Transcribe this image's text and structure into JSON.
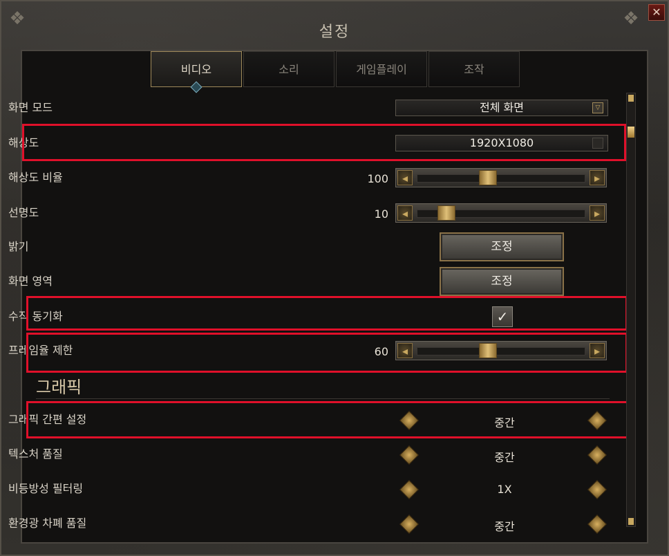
{
  "window": {
    "title": "설정",
    "close_label": "✕"
  },
  "tabs": [
    {
      "label": "비디오",
      "active": true
    },
    {
      "label": "소리",
      "active": false
    },
    {
      "label": "게임플레이",
      "active": false
    },
    {
      "label": "조작",
      "active": false
    }
  ],
  "settings": {
    "screen_mode": {
      "label": "화면 모드",
      "value": "전체 화면",
      "control": "dropdown"
    },
    "resolution": {
      "label": "해상도",
      "value": "1920X1080",
      "control": "dropdown"
    },
    "resolution_scale": {
      "label": "해상도 비율",
      "value": "100",
      "control": "slider",
      "level": 0.4
    },
    "sharpness": {
      "label": "선명도",
      "value": "10",
      "control": "slider",
      "level": 0.1
    },
    "brightness": {
      "label": "밝기",
      "button": "조정"
    },
    "screen_area": {
      "label": "화면 영역",
      "button": "조정"
    },
    "vsync": {
      "label": "수직 동기화",
      "checked": true,
      "check_glyph": "✓"
    },
    "frame_limit": {
      "label": "프레임율 제한",
      "value": "60",
      "control": "slider",
      "level": 0.4
    }
  },
  "graphics": {
    "section_title": "그래픽",
    "items": [
      {
        "label": "그래픽 간편 설정",
        "value": "중간"
      },
      {
        "label": "텍스처 품질",
        "value": "중간"
      },
      {
        "label": "비등방성 필터링",
        "value": "1X"
      },
      {
        "label": "환경광 차폐 품질",
        "value": "중간"
      }
    ]
  },
  "icons": {
    "arrow_left": "◂",
    "arrow_right": "▸",
    "dropdown": "▽",
    "corner": "❖"
  },
  "colors": {
    "highlight": "#e0102a",
    "accent": "#c8a860"
  }
}
